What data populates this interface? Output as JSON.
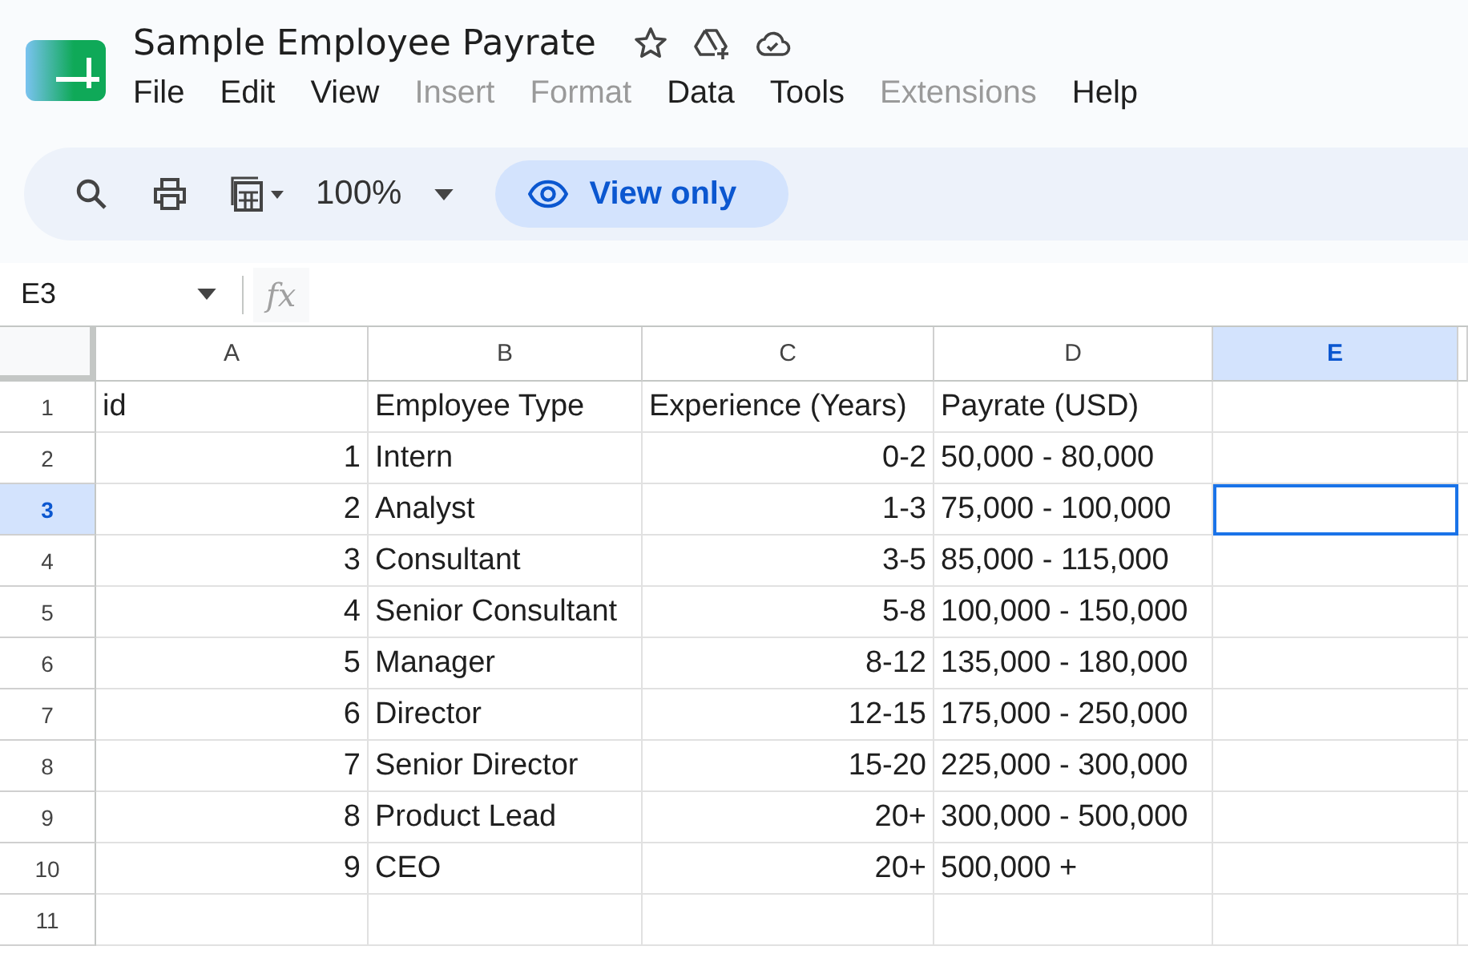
{
  "title": "Sample Employee Payrate",
  "menu": [
    {
      "label": "File",
      "disabled": false
    },
    {
      "label": "Edit",
      "disabled": false
    },
    {
      "label": "View",
      "disabled": false
    },
    {
      "label": "Insert",
      "disabled": true
    },
    {
      "label": "Format",
      "disabled": true
    },
    {
      "label": "Data",
      "disabled": false
    },
    {
      "label": "Tools",
      "disabled": false
    },
    {
      "label": "Extensions",
      "disabled": true
    },
    {
      "label": "Help",
      "disabled": false
    }
  ],
  "toolbar": {
    "zoom": "100%",
    "mode_button": "View only"
  },
  "name_box": "E3",
  "formula_label": "fx",
  "columns": [
    {
      "label": "A",
      "selected": false
    },
    {
      "label": "B",
      "selected": false
    },
    {
      "label": "C",
      "selected": false
    },
    {
      "label": "D",
      "selected": false
    },
    {
      "label": "E",
      "selected": true
    }
  ],
  "rows": [
    {
      "number": "1",
      "selected": false,
      "cells": [
        {
          "text": "id",
          "kind": "text"
        },
        {
          "text": "Employee Type",
          "kind": "text"
        },
        {
          "text": "Experience (Years)",
          "kind": "text"
        },
        {
          "text": "Payrate (USD)",
          "kind": "text"
        }
      ]
    },
    {
      "number": "2",
      "selected": false,
      "cells": [
        {
          "text": "1",
          "kind": "number"
        },
        {
          "text": "Intern",
          "kind": "text"
        },
        {
          "text": "0-2",
          "kind": "number"
        },
        {
          "text": "50,000 - 80,000",
          "kind": "text"
        }
      ]
    },
    {
      "number": "3",
      "selected": true,
      "cells": [
        {
          "text": "2",
          "kind": "number"
        },
        {
          "text": "Analyst",
          "kind": "text"
        },
        {
          "text": "1-3",
          "kind": "number"
        },
        {
          "text": "75,000 - 100,000",
          "kind": "text"
        }
      ]
    },
    {
      "number": "4",
      "selected": false,
      "cells": [
        {
          "text": "3",
          "kind": "number"
        },
        {
          "text": "Consultant",
          "kind": "text"
        },
        {
          "text": "3-5",
          "kind": "number"
        },
        {
          "text": "85,000 - 115,000",
          "kind": "text"
        }
      ]
    },
    {
      "number": "5",
      "selected": false,
      "cells": [
        {
          "text": "4",
          "kind": "number"
        },
        {
          "text": "Senior Consultant",
          "kind": "text"
        },
        {
          "text": "5-8",
          "kind": "number"
        },
        {
          "text": "100,000 - 150,000",
          "kind": "text"
        }
      ]
    },
    {
      "number": "6",
      "selected": false,
      "cells": [
        {
          "text": "5",
          "kind": "number"
        },
        {
          "text": "Manager",
          "kind": "text"
        },
        {
          "text": "8-12",
          "kind": "number"
        },
        {
          "text": "135,000 - 180,000",
          "kind": "text"
        }
      ]
    },
    {
      "number": "7",
      "selected": false,
      "cells": [
        {
          "text": "6",
          "kind": "number"
        },
        {
          "text": "Director",
          "kind": "text"
        },
        {
          "text": "12-15",
          "kind": "number"
        },
        {
          "text": "175,000 - 250,000",
          "kind": "text"
        }
      ]
    },
    {
      "number": "8",
      "selected": false,
      "cells": [
        {
          "text": "7",
          "kind": "number"
        },
        {
          "text": "Senior Director",
          "kind": "text"
        },
        {
          "text": "15-20",
          "kind": "number"
        },
        {
          "text": "225,000 - 300,000",
          "kind": "text"
        }
      ]
    },
    {
      "number": "9",
      "selected": false,
      "cells": [
        {
          "text": "8",
          "kind": "number"
        },
        {
          "text": "Product Lead",
          "kind": "text"
        },
        {
          "text": "20+",
          "kind": "number"
        },
        {
          "text": "300,000 - 500,000",
          "kind": "text"
        }
      ]
    },
    {
      "number": "10",
      "selected": false,
      "cells": [
        {
          "text": "9",
          "kind": "number"
        },
        {
          "text": "CEO",
          "kind": "text"
        },
        {
          "text": "20+",
          "kind": "number"
        },
        {
          "text": "500,000 +",
          "kind": "text"
        }
      ]
    },
    {
      "number": "11",
      "selected": false
    }
  ]
}
